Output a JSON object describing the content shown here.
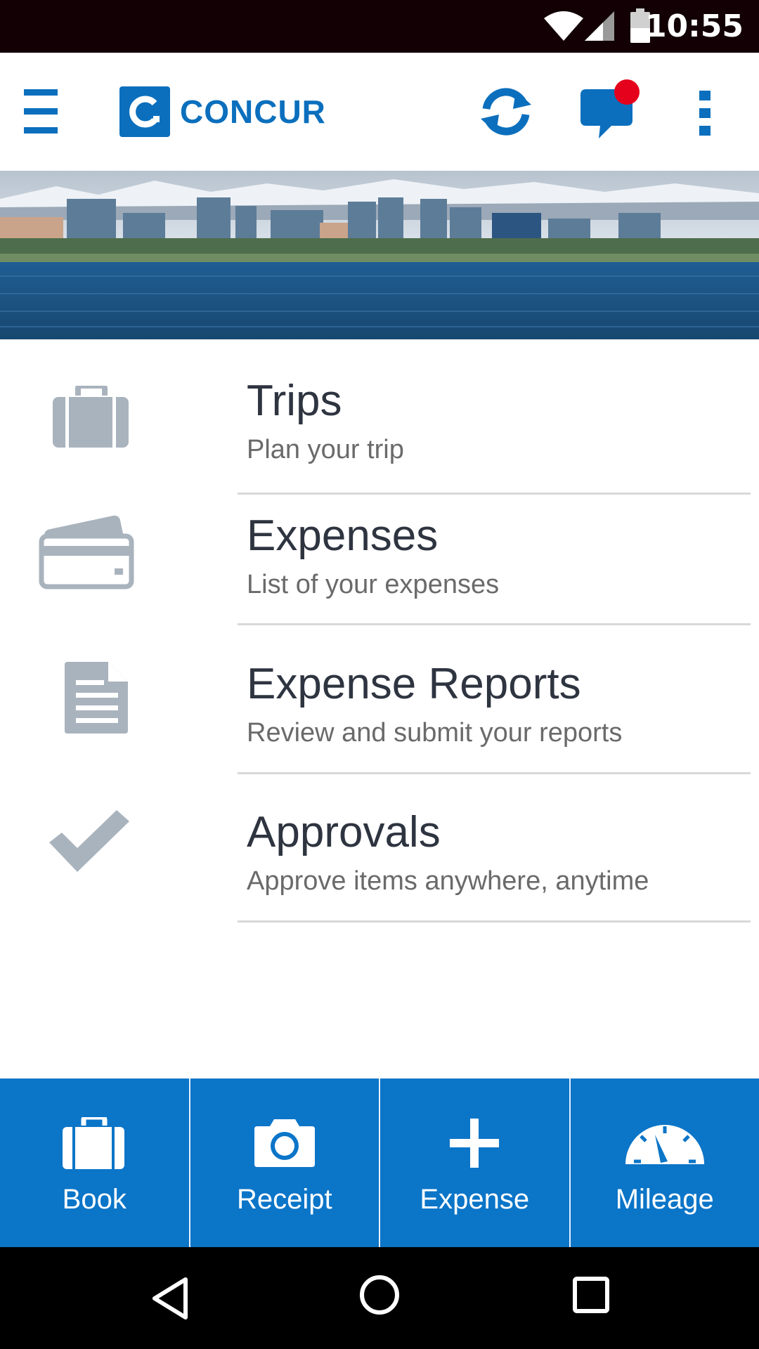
{
  "status_bar": {
    "time": "10:55",
    "icons": [
      "wifi-icon",
      "cellular-signal-icon",
      "battery-icon"
    ]
  },
  "app_bar": {
    "brand": "CONCUR",
    "icons": [
      "hamburger-menu-icon",
      "sync-icon",
      "messages-icon",
      "overflow-menu-icon"
    ],
    "accent_color": "#0b6fbd",
    "notification_dot_color": "#e5001c"
  },
  "menu": {
    "items": [
      {
        "title": "Trips",
        "subtitle": "Plan your trip",
        "icon": "briefcase-icon"
      },
      {
        "title": "Expenses",
        "subtitle": "List of your expenses",
        "icon": "credit-card-icon"
      },
      {
        "title": "Expense Reports",
        "subtitle": "Review and submit your reports",
        "icon": "document-icon"
      },
      {
        "title": "Approvals",
        "subtitle": "Approve items anywhere, anytime",
        "icon": "checkmark-icon"
      }
    ]
  },
  "actions": {
    "items": [
      {
        "label": "Book",
        "icon": "briefcase-icon"
      },
      {
        "label": "Receipt",
        "icon": "camera-icon"
      },
      {
        "label": "Expense",
        "icon": "plus-icon"
      },
      {
        "label": "Mileage",
        "icon": "speedometer-icon"
      }
    ],
    "background_color": "#0b75c8"
  },
  "nav_bar": {
    "icons": [
      "back-icon",
      "home-icon",
      "recents-icon"
    ]
  }
}
